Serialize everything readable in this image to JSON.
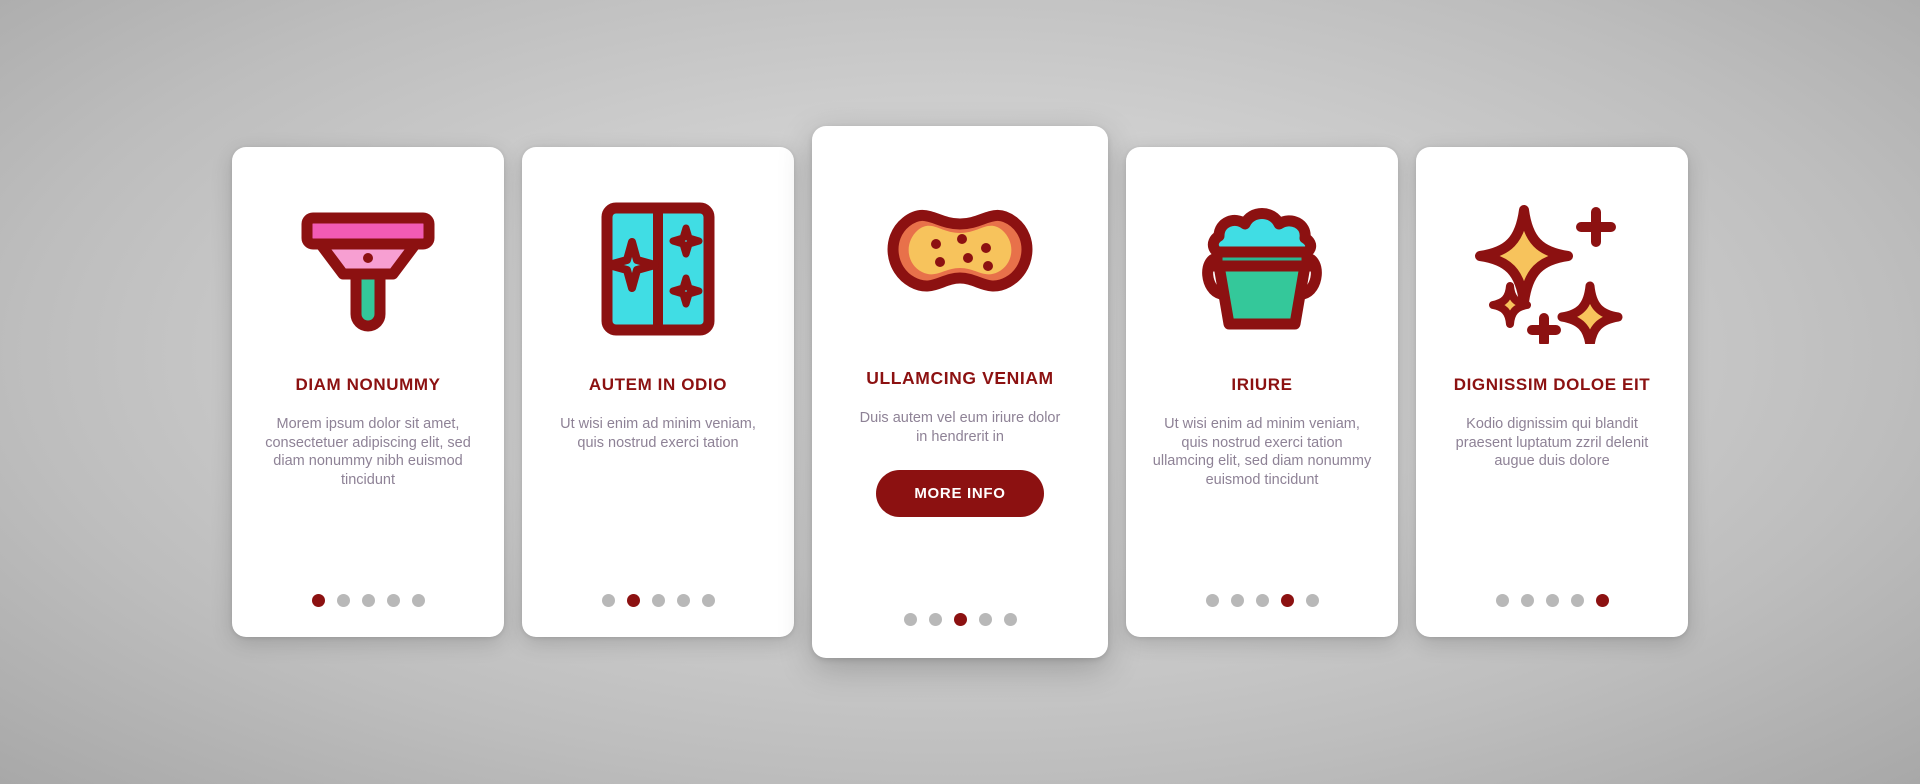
{
  "theme": {
    "accent": "#8c1111",
    "title_color": "#8c1111",
    "body_text_color": "#8e8296",
    "card_background": "#ffffff",
    "page_background": "#c6c6c6",
    "dot_inactive": "#b8b8b8",
    "dot_active": "#8c1111",
    "icon_outline": "#8c1111",
    "icon_pink": "#f25bb4",
    "icon_pink_light": "#f79fd2",
    "icon_green": "#34c89a",
    "icon_cyan": "#40dde4",
    "icon_teal": "#2bb894",
    "icon_yellow": "#f7c35c",
    "icon_orange": "#e8714a"
  },
  "cards": [
    {
      "icon": "squeegee-icon",
      "title": "DIAM NONUMMY",
      "body": "Morem ipsum dolor sit amet, consectetuer adipiscing elit, sed diam nonummy nibh euismod tincidunt",
      "featured": false,
      "dots": {
        "count": 5,
        "active": 0
      }
    },
    {
      "icon": "clean-window-icon",
      "title": "AUTEM IN ODIO",
      "body": "Ut wisi enim ad minim veniam, quis nostrud exerci tation",
      "featured": false,
      "dots": {
        "count": 5,
        "active": 1
      }
    },
    {
      "icon": "sponge-icon",
      "title": "ULLAMCING VENIAM",
      "body": "Duis autem vel eum iriure dolor in hendrerit in",
      "button_label": "MORE INFO",
      "featured": true,
      "dots": {
        "count": 5,
        "active": 2
      }
    },
    {
      "icon": "bucket-foam-icon",
      "title": "IRIURE",
      "body": "Ut wisi enim ad minim veniam, quis nostrud exerci tation ullamcing elit, sed diam nonummy euismod tincidunt",
      "featured": false,
      "dots": {
        "count": 5,
        "active": 3
      }
    },
    {
      "icon": "sparkle-shine-icon",
      "title": "DIGNISSIM DOLOE EIT",
      "body": "Kodio dignissim qui blandit praesent luptatum zzril delenit augue duis dolore",
      "featured": false,
      "dots": {
        "count": 5,
        "active": 4
      }
    }
  ]
}
